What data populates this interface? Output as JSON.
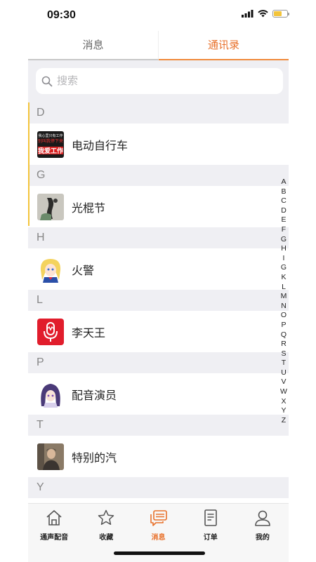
{
  "status": {
    "time": "09:30"
  },
  "tabs": [
    {
      "label": "消息"
    },
    {
      "label": "通讯录"
    }
  ],
  "search": {
    "placeholder": "搜索"
  },
  "sections": [
    {
      "letter": "D",
      "contacts": [
        {
          "name": "电动自行车",
          "avatar": "poster-avatar"
        }
      ]
    },
    {
      "letter": "G",
      "contacts": [
        {
          "name": "光棍节",
          "avatar": "ink-painting-avatar"
        }
      ]
    },
    {
      "letter": "H",
      "contacts": [
        {
          "name": "火警",
          "avatar": "anime-girl-avatar"
        }
      ]
    },
    {
      "letter": "L",
      "contacts": [
        {
          "name": "李天王",
          "avatar": "microphone-avatar"
        }
      ]
    },
    {
      "letter": "P",
      "contacts": [
        {
          "name": "配音演员",
          "avatar": "anime-purple-hair-avatar"
        }
      ]
    },
    {
      "letter": "T",
      "contacts": [
        {
          "name": "特别的汽",
          "avatar": "person-photo-avatar"
        }
      ]
    },
    {
      "letter": "Y",
      "contacts": []
    }
  ],
  "avatar_text": {
    "line1": "我心里只有工作",
    "line2": "别叫我停下来",
    "line3": "我爱工作"
  },
  "index_letters": [
    "A",
    "B",
    "C",
    "D",
    "E",
    "F",
    "G",
    "H",
    "I",
    "G",
    "K",
    "L",
    "M",
    "N",
    "O",
    "P",
    "Q",
    "R",
    "S",
    "T",
    "U",
    "V",
    "W",
    "X",
    "Y",
    "Z"
  ],
  "bottom_nav": [
    {
      "label": "通声配音",
      "icon": "home-icon"
    },
    {
      "label": "收藏",
      "icon": "star-icon"
    },
    {
      "label": "消息",
      "icon": "chat-icon",
      "active": true
    },
    {
      "label": "订单",
      "icon": "document-icon"
    },
    {
      "label": "我的",
      "icon": "person-icon"
    }
  ],
  "colors": {
    "accent": "#e8702a",
    "background": "#efeff3",
    "highlight_bar": "#f3c43b"
  }
}
